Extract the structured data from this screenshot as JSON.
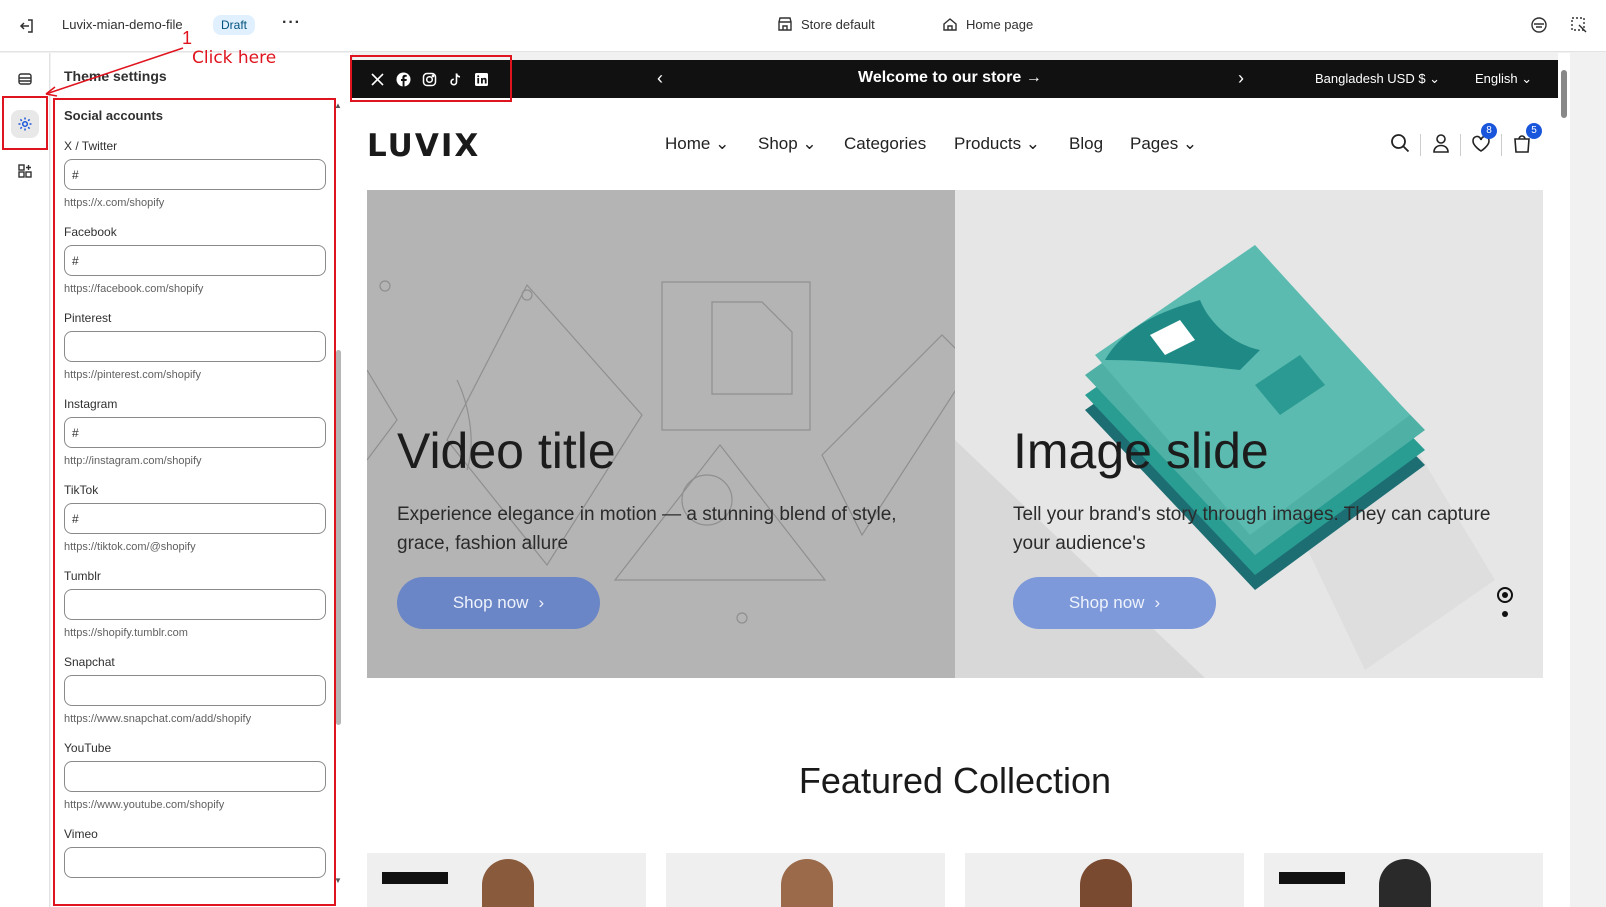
{
  "topbar": {
    "file_name": "Luvix-mian-demo-file",
    "status_badge": "Draft",
    "more_label": "···",
    "store_label": "Store default",
    "page_label": "Home page"
  },
  "annotation": {
    "step_number": "1",
    "instruction": "Click here"
  },
  "panel": {
    "title": "Theme settings",
    "section": "Social accounts",
    "fields": [
      {
        "label": "X / Twitter",
        "value": "#",
        "hint": "https://x.com/shopify"
      },
      {
        "label": "Facebook",
        "value": "#",
        "hint": "https://facebook.com/shopify"
      },
      {
        "label": "Pinterest",
        "value": "",
        "hint": "https://pinterest.com/shopify"
      },
      {
        "label": "Instagram",
        "value": "#",
        "hint": "http://instagram.com/shopify"
      },
      {
        "label": "TikTok",
        "value": "#",
        "hint": "https://tiktok.com/@shopify"
      },
      {
        "label": "Tumblr",
        "value": "",
        "hint": "https://shopify.tumblr.com"
      },
      {
        "label": "Snapchat",
        "value": "",
        "hint": "https://www.snapchat.com/add/shopify"
      },
      {
        "label": "YouTube",
        "value": "",
        "hint": "https://www.youtube.com/shopify"
      },
      {
        "label": "Vimeo",
        "value": "",
        "hint": ""
      }
    ]
  },
  "preview": {
    "announcement": {
      "text": "Welcome to our store →",
      "country": "Bangladesh USD $ ⌄",
      "language": "English ⌄"
    },
    "logo": "LUVIX",
    "nav": [
      "Home ⌄",
      "Shop ⌄",
      "Categories",
      "Products ⌄",
      "Blog",
      "Pages ⌄"
    ],
    "wishlist_count": "8",
    "cart_count": "5",
    "slides": [
      {
        "title": "Video title",
        "text": "Experience elegance in motion — a stunning blend of style, grace, fashion allure",
        "button": "Shop now"
      },
      {
        "title": "Image slide",
        "text": "Tell your brand's story through images. They can capture your audience's",
        "button": "Shop now"
      }
    ],
    "featured_title": "Featured Collection"
  },
  "colors": {
    "accent_red": "#e0141e",
    "badge_blue": "#1a56db",
    "button_blue": "#6b86c6",
    "teal_shirt": "#2a9d93"
  }
}
